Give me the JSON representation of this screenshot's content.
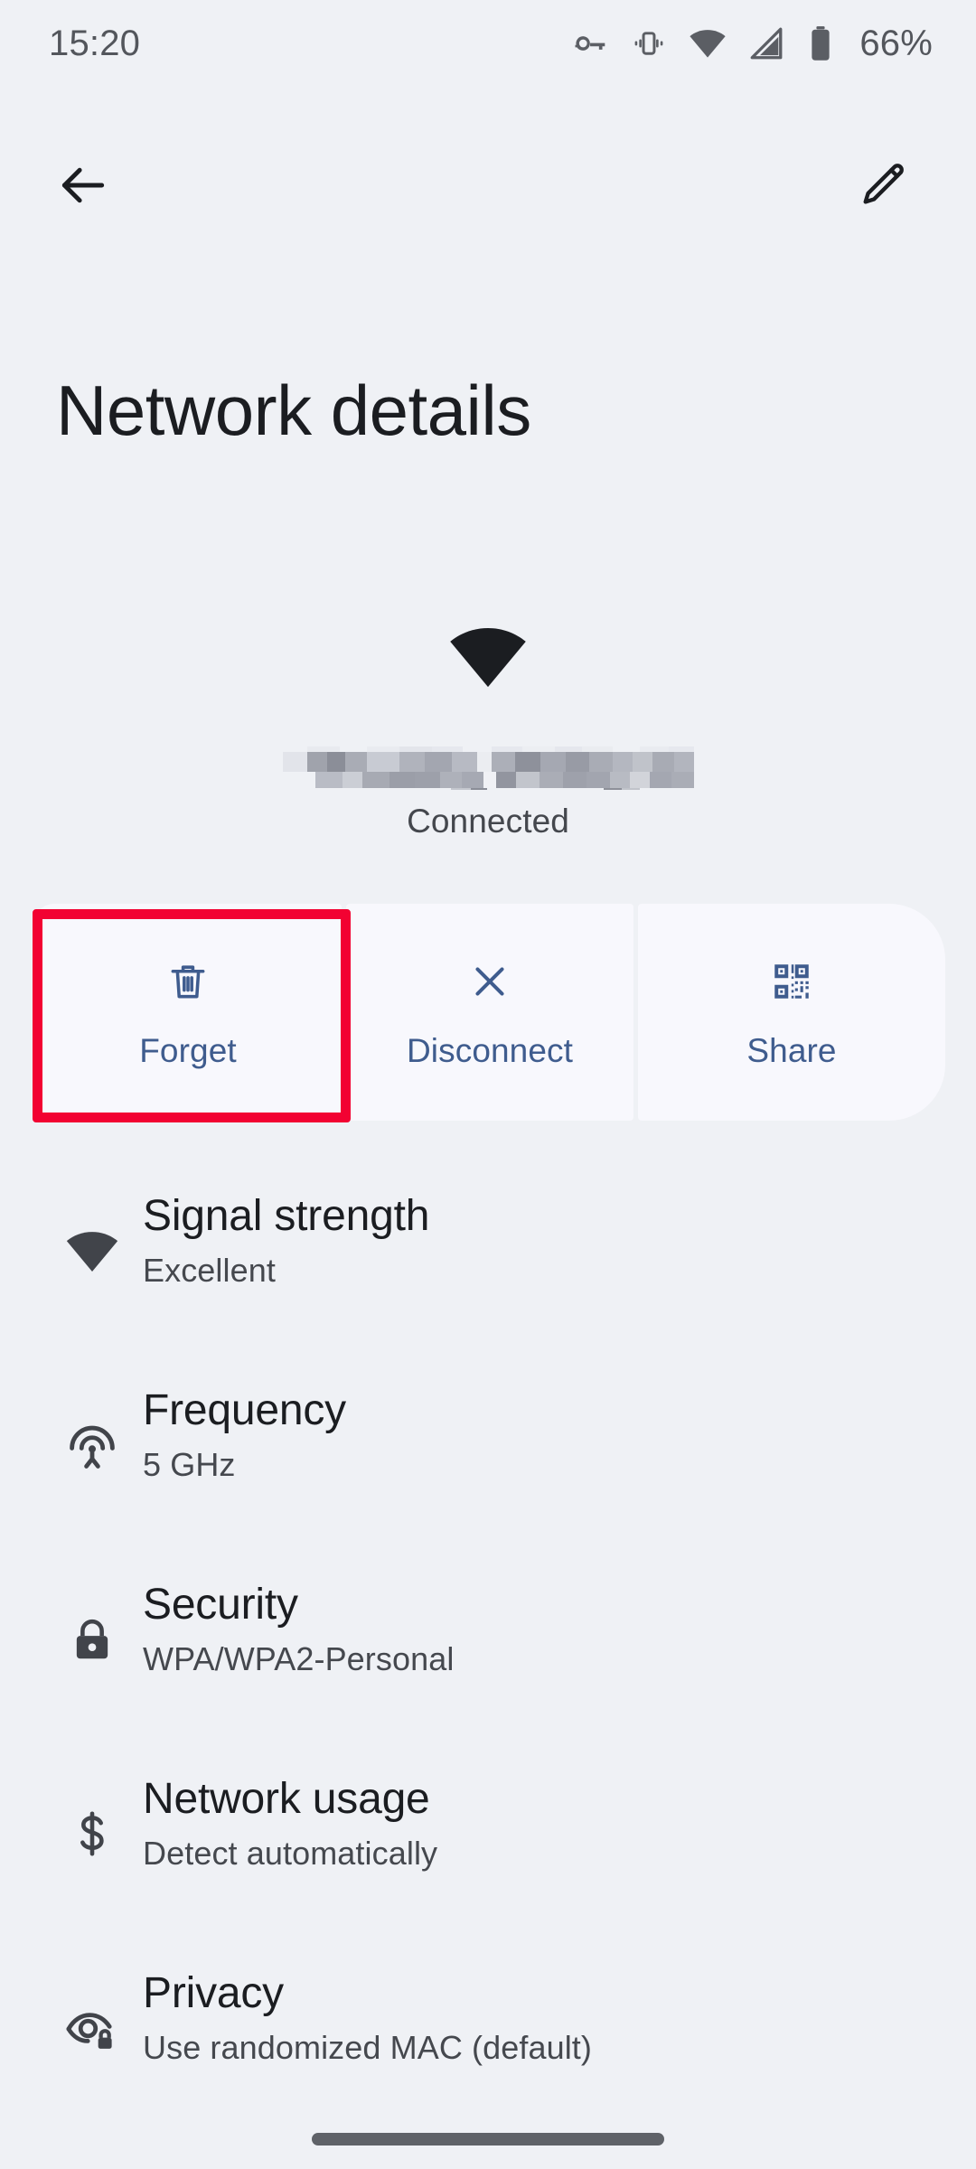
{
  "status_bar": {
    "time": "15:20",
    "battery_percent": "66%",
    "icons": [
      "vpn-key-icon",
      "vibrate-icon",
      "wifi-icon",
      "cellular-signal-icon",
      "battery-icon"
    ]
  },
  "app_bar": {
    "back_icon": "back-arrow-icon",
    "edit_icon": "pencil-edit-icon"
  },
  "page": {
    "title": "Network details"
  },
  "network": {
    "wifi_icon": "wifi-full-icon",
    "ssid": "",
    "ssid_redacted": true,
    "status": "Connected"
  },
  "actions": [
    {
      "label": "Forget",
      "icon": "trash-icon",
      "highlighted": true
    },
    {
      "label": "Disconnect",
      "icon": "close-x-icon",
      "highlighted": false
    },
    {
      "label": "Share",
      "icon": "qr-code-icon",
      "highlighted": false
    }
  ],
  "details": [
    {
      "icon": "wifi-signal-icon",
      "title": "Signal strength",
      "value": "Excellent"
    },
    {
      "icon": "broadcast-icon",
      "title": "Frequency",
      "value": "5 GHz"
    },
    {
      "icon": "lock-icon",
      "title": "Security",
      "value": "WPA/WPA2-Personal"
    },
    {
      "icon": "dollar-icon",
      "title": "Network usage",
      "value": "Detect automatically"
    },
    {
      "icon": "eye-lock-icon",
      "title": "Privacy",
      "value": "Use randomized MAC (default)"
    }
  ],
  "nav_bar": {
    "pill": "gesture-nav-pill"
  },
  "colors": {
    "page_background": "#eff1f5",
    "card_background": "#f8f8fd",
    "accent_blue": "#3f5c8e",
    "highlight_red": "#f20232",
    "text_primary": "#1b1d21",
    "text_secondary": "#45484e"
  }
}
